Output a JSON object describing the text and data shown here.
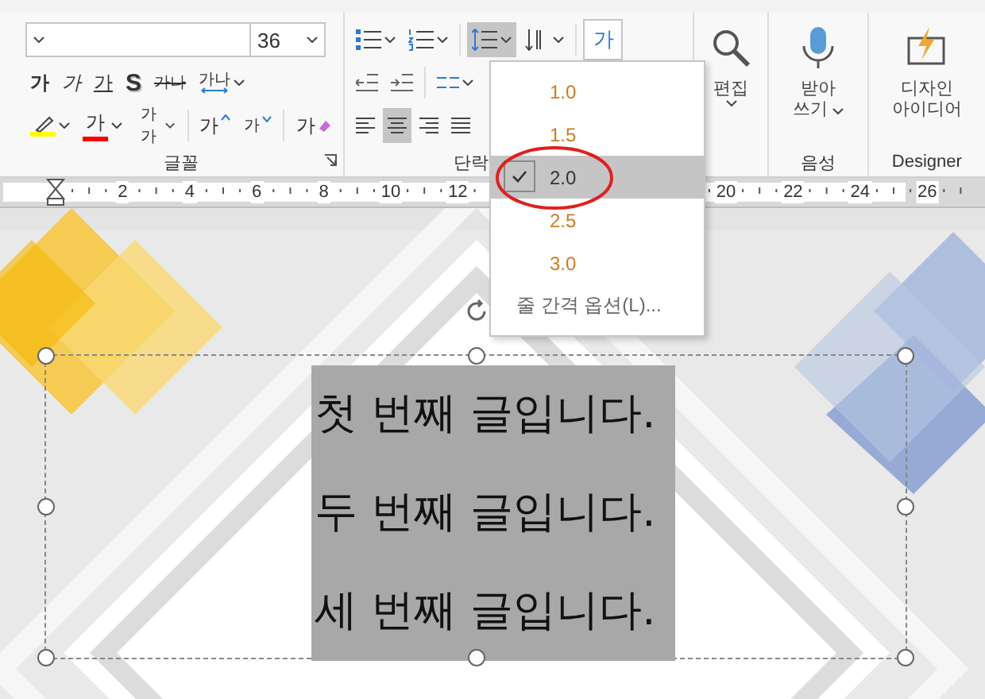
{
  "ribbon": {
    "font_group": {
      "label": "글꼴",
      "font_size": "36",
      "format_buttons": [
        {
          "kind": "bold",
          "text": "가"
        },
        {
          "kind": "italic",
          "text": "가"
        },
        {
          "kind": "underline",
          "text": "가"
        },
        {
          "kind": "shadow",
          "text": "S"
        },
        {
          "kind": "strike",
          "text": "가나"
        },
        {
          "kind": "spacing",
          "text": "가나"
        }
      ],
      "color_buttons": [
        {
          "kind": "highlight",
          "color": "#ffff00"
        },
        {
          "kind": "font_color",
          "text": "가",
          "color": "#ff0000"
        },
        {
          "kind": "case",
          "text": "가가"
        },
        {
          "kind": "grow",
          "text": "가"
        },
        {
          "kind": "shrink",
          "text": "가"
        },
        {
          "kind": "clear",
          "text": "가"
        }
      ]
    },
    "paragraph_group": {
      "label": "단락",
      "line_spacing_expanded": true,
      "text_direction": "가",
      "align": [
        {
          "kind": "left",
          "selected": false
        },
        {
          "kind": "center",
          "selected": true
        },
        {
          "kind": "right",
          "selected": false
        },
        {
          "kind": "justify",
          "selected": false
        }
      ]
    },
    "edit_group": {
      "button": "편집"
    },
    "voice_group": {
      "label": "음성",
      "button_lines": [
        "받아",
        "쓰기"
      ]
    },
    "designer_group": {
      "label": "Designer",
      "button_lines": [
        "디자인",
        "아이디어"
      ]
    }
  },
  "ruler": {
    "numbers": [
      "2",
      "4",
      "6",
      "8",
      "10",
      "12",
      "20",
      "22",
      "24",
      "26"
    ]
  },
  "slide": {
    "text_selected": true,
    "lines": [
      "첫 번째 글입니다.",
      "두 번째 글입니다.",
      "세 번째 글입니다."
    ]
  },
  "line_spacing_menu": {
    "items": [
      {
        "label": "1.0",
        "selected": false
      },
      {
        "label": "1.5",
        "selected": false
      },
      {
        "label": "2.0",
        "selected": true
      },
      {
        "label": "2.5",
        "selected": false
      },
      {
        "label": "3.0",
        "selected": false
      }
    ],
    "options": "줄 간격 옵션(L)..."
  }
}
